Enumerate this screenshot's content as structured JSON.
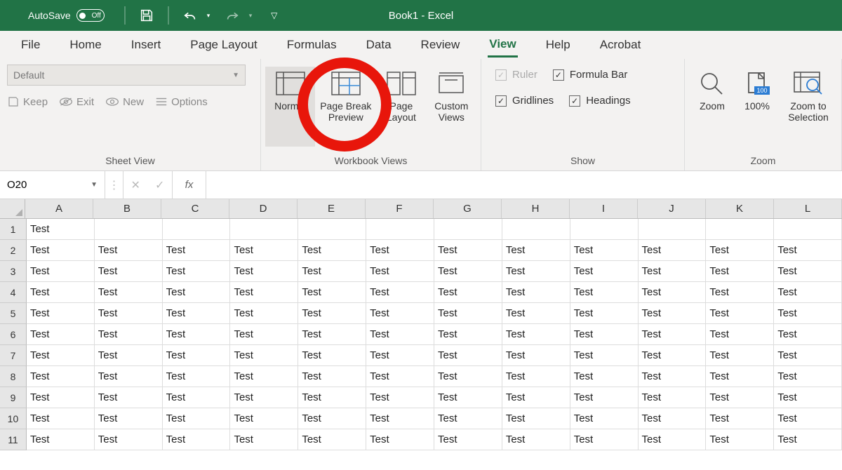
{
  "titlebar": {
    "autosave_label": "AutoSave",
    "autosave_state": "Off",
    "title": "Book1  -  Excel"
  },
  "tabs": [
    "File",
    "Home",
    "Insert",
    "Page Layout",
    "Formulas",
    "Data",
    "Review",
    "View",
    "Help",
    "Acrobat"
  ],
  "active_tab": "View",
  "ribbon": {
    "sheet_view": {
      "select_value": "Default",
      "keep": "Keep",
      "exit": "Exit",
      "new": "New",
      "options": "Options",
      "group_label": "Sheet View"
    },
    "workbook_views": {
      "normal": "Normal",
      "page_break": "Page Break Preview",
      "page_layout": "Page Layout",
      "custom_views": "Custom Views",
      "group_label": "Workbook Views"
    },
    "show": {
      "ruler": "Ruler",
      "formula_bar": "Formula Bar",
      "gridlines": "Gridlines",
      "headings": "Headings",
      "group_label": "Show"
    },
    "zoom": {
      "zoom": "Zoom",
      "hundred": "100%",
      "selection": "Zoom to Selection",
      "group_label": "Zoom"
    }
  },
  "formula_bar": {
    "name_box": "O20",
    "fx": "fx",
    "value": ""
  },
  "columns": [
    "A",
    "B",
    "C",
    "D",
    "E",
    "F",
    "G",
    "H",
    "I",
    "J",
    "K",
    "L"
  ],
  "rows": [
    {
      "n": "1",
      "cells": [
        "Test",
        "",
        "",
        "",
        "",
        "",
        "",
        "",
        "",
        "",
        "",
        ""
      ]
    },
    {
      "n": "2",
      "cells": [
        "Test",
        "Test",
        "Test",
        "Test",
        "Test",
        "Test",
        "Test",
        "Test",
        "Test",
        "Test",
        "Test",
        "Test"
      ]
    },
    {
      "n": "3",
      "cells": [
        "Test",
        "Test",
        "Test",
        "Test",
        "Test",
        "Test",
        "Test",
        "Test",
        "Test",
        "Test",
        "Test",
        "Test"
      ]
    },
    {
      "n": "4",
      "cells": [
        "Test",
        "Test",
        "Test",
        "Test",
        "Test",
        "Test",
        "Test",
        "Test",
        "Test",
        "Test",
        "Test",
        "Test"
      ]
    },
    {
      "n": "5",
      "cells": [
        "Test",
        "Test",
        "Test",
        "Test",
        "Test",
        "Test",
        "Test",
        "Test",
        "Test",
        "Test",
        "Test",
        "Test"
      ]
    },
    {
      "n": "6",
      "cells": [
        "Test",
        "Test",
        "Test",
        "Test",
        "Test",
        "Test",
        "Test",
        "Test",
        "Test",
        "Test",
        "Test",
        "Test"
      ]
    },
    {
      "n": "7",
      "cells": [
        "Test",
        "Test",
        "Test",
        "Test",
        "Test",
        "Test",
        "Test",
        "Test",
        "Test",
        "Test",
        "Test",
        "Test"
      ]
    },
    {
      "n": "8",
      "cells": [
        "Test",
        "Test",
        "Test",
        "Test",
        "Test",
        "Test",
        "Test",
        "Test",
        "Test",
        "Test",
        "Test",
        "Test"
      ]
    },
    {
      "n": "9",
      "cells": [
        "Test",
        "Test",
        "Test",
        "Test",
        "Test",
        "Test",
        "Test",
        "Test",
        "Test",
        "Test",
        "Test",
        "Test"
      ]
    },
    {
      "n": "10",
      "cells": [
        "Test",
        "Test",
        "Test",
        "Test",
        "Test",
        "Test",
        "Test",
        "Test",
        "Test",
        "Test",
        "Test",
        "Test"
      ]
    },
    {
      "n": "11",
      "cells": [
        "Test",
        "Test",
        "Test",
        "Test",
        "Test",
        "Test",
        "Test",
        "Test",
        "Test",
        "Test",
        "Test",
        "Test"
      ]
    }
  ]
}
